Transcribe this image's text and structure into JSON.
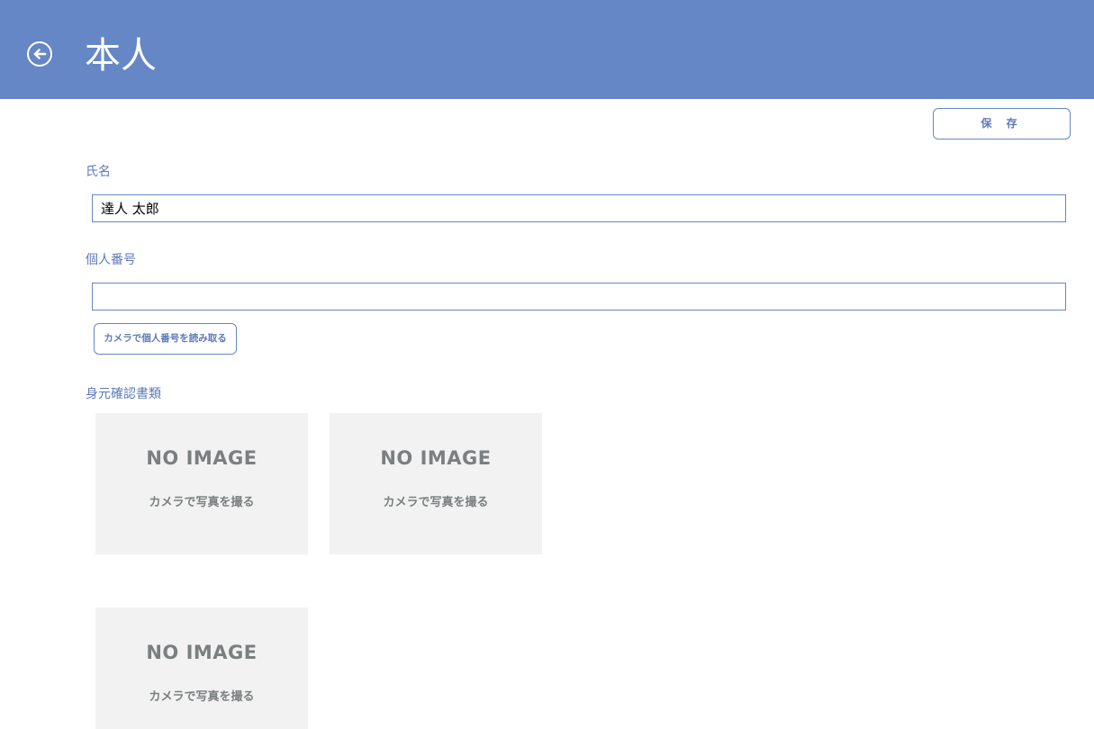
{
  "header": {
    "title": "本人",
    "back_icon": "arrow-left-circle-icon",
    "background_color": "#6587c5"
  },
  "toolbar": {
    "save_label": "保 存"
  },
  "form": {
    "name": {
      "label": "氏名",
      "value": "達人 太郎"
    },
    "personal_number": {
      "label": "個人番号",
      "value": "",
      "camera_button_label": "カメラで個人番号を読み取る"
    },
    "id_documents": {
      "label": "身元確認書類",
      "slots": [
        {
          "title": "NO IMAGE",
          "caption": "カメラで写真を撮る"
        },
        {
          "title": "NO IMAGE",
          "caption": "カメラで写真を撮る"
        },
        {
          "title": "NO IMAGE",
          "caption": "カメラで写真を撮る"
        }
      ]
    }
  },
  "colors": {
    "accent": "#6587c5",
    "label_text": "#5d7ab8",
    "placeholder_bg": "#f2f2f2",
    "placeholder_text": "#7b7f80"
  }
}
